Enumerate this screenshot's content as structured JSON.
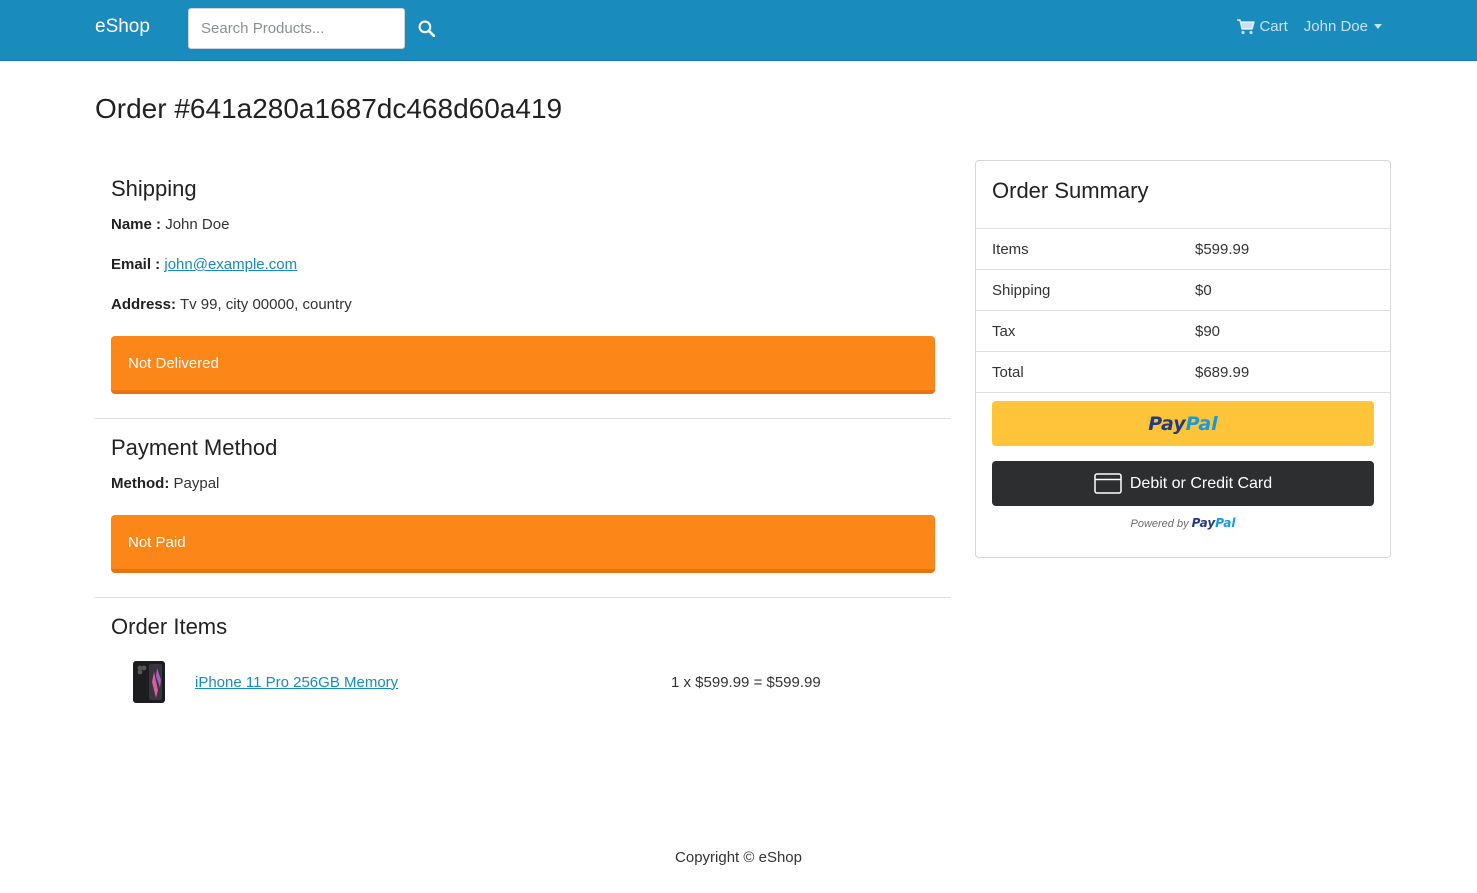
{
  "navbar": {
    "brand": "eShop",
    "search_placeholder": "Search Products...",
    "search_icon": "search-icon",
    "cart_label": "Cart",
    "cart_icon": "shopping-cart-icon",
    "user_label": "John Doe",
    "bg_color": "#1a8bbd"
  },
  "order": {
    "title": "Order #641a280a1687dc468d60a419"
  },
  "shipping": {
    "heading": "Shipping",
    "name_label": "Name :",
    "name_value": "John Doe",
    "email_label": "Email :",
    "email_value": "john@example.com",
    "address_label": "Address:",
    "address_value": "Tv 99, city 00000, country",
    "status": "Not Delivered"
  },
  "payment": {
    "heading": "Payment Method",
    "method_label": "Method:",
    "method_value": "Paypal",
    "status": "Not Paid"
  },
  "items": {
    "heading": "Order Items",
    "list": [
      {
        "name": "iPhone 11 Pro 256GB Memory",
        "price_line": "1 x $599.99 = $599.99",
        "thumb_icon": "phone-thumbnail"
      }
    ]
  },
  "summary": {
    "heading": "Order Summary",
    "rows": [
      {
        "label": "Items",
        "value": "$599.99"
      },
      {
        "label": "Shipping",
        "value": "$0"
      },
      {
        "label": "Tax",
        "value": "$90"
      },
      {
        "label": "Total",
        "value": "$689.99"
      }
    ],
    "paypal_pay": "Pay",
    "paypal_pal": "Pal",
    "card_button": "Debit or Credit Card",
    "powered_by": "Powered by",
    "powered_pay": "Pay",
    "powered_pal": "Pal",
    "alert_color": "#fd8618",
    "paypal_color": "#ffc439"
  },
  "footer": {
    "text": "Copyright © eShop"
  }
}
